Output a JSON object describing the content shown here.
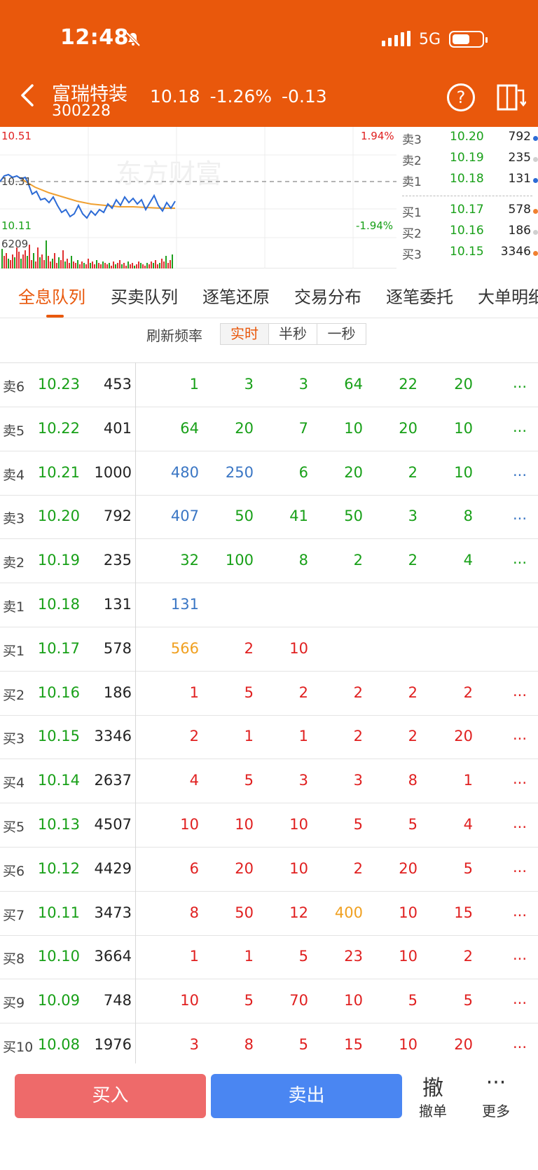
{
  "status": {
    "time": "12:48",
    "network": "5G"
  },
  "stock": {
    "name": "富瑞特装",
    "code": "300228",
    "price": "10.18",
    "pct": "-1.26%",
    "change": "-0.13"
  },
  "chart": {
    "price_high": "10.51",
    "price_low": "10.11",
    "pct_high": "1.94%",
    "pct_low": "-1.94%",
    "volume_label": "6209",
    "ref_label": "10.31",
    "watermark": "东方财富",
    "colors": {
      "price": "#2c6bd6",
      "avg": "#f0a030",
      "vol_up": "#e03030",
      "vol_down": "#20a020"
    }
  },
  "book": {
    "asks": [
      {
        "label": "卖3",
        "price": "10.20",
        "vol": "792",
        "dot": "#2c6bd6"
      },
      {
        "label": "卖2",
        "price": "10.19",
        "vol": "235",
        "dot": "#d0d0d0"
      },
      {
        "label": "卖1",
        "price": "10.18",
        "vol": "131",
        "dot": "#2c6bd6"
      }
    ],
    "bids": [
      {
        "label": "买1",
        "price": "10.17",
        "vol": "578",
        "dot": "#f08030"
      },
      {
        "label": "买2",
        "price": "10.16",
        "vol": "186",
        "dot": "#d0d0d0"
      },
      {
        "label": "买3",
        "price": "10.15",
        "vol": "3346",
        "dot": "#f08030"
      }
    ]
  },
  "tabs": [
    "全息队列",
    "买卖队列",
    "逐笔还原",
    "交易分布",
    "逐笔委托",
    "大单明细"
  ],
  "refresh": {
    "label": "刷新频率",
    "options": [
      "实时",
      "半秒",
      "一秒"
    ]
  },
  "queue": [
    {
      "label": "卖6",
      "price": "10.23",
      "vol": "453",
      "orders": [
        [
          "1",
          "g"
        ],
        [
          "3",
          "g"
        ],
        [
          "3",
          "g"
        ],
        [
          "64",
          "g"
        ],
        [
          "22",
          "g"
        ],
        [
          "20",
          "g"
        ]
      ],
      "more": "..."
    },
    {
      "label": "卖5",
      "price": "10.22",
      "vol": "401",
      "orders": [
        [
          "64",
          "g"
        ],
        [
          "20",
          "g"
        ],
        [
          "7",
          "g"
        ],
        [
          "10",
          "g"
        ],
        [
          "20",
          "g"
        ],
        [
          "10",
          "g"
        ]
      ],
      "more": "..."
    },
    {
      "label": "卖4",
      "price": "10.21",
      "vol": "1000",
      "orders": [
        [
          "480",
          "b"
        ],
        [
          "250",
          "b"
        ],
        [
          "6",
          "g"
        ],
        [
          "20",
          "g"
        ],
        [
          "2",
          "g"
        ],
        [
          "10",
          "g"
        ]
      ],
      "more": "..."
    },
    {
      "label": "卖3",
      "price": "10.20",
      "vol": "792",
      "orders": [
        [
          "407",
          "b"
        ],
        [
          "50",
          "g"
        ],
        [
          "41",
          "g"
        ],
        [
          "50",
          "g"
        ],
        [
          "3",
          "g"
        ],
        [
          "8",
          "g"
        ]
      ],
      "more": "..."
    },
    {
      "label": "卖2",
      "price": "10.19",
      "vol": "235",
      "orders": [
        [
          "32",
          "g"
        ],
        [
          "100",
          "g"
        ],
        [
          "8",
          "g"
        ],
        [
          "2",
          "g"
        ],
        [
          "2",
          "g"
        ],
        [
          "4",
          "g"
        ]
      ],
      "more": "..."
    },
    {
      "label": "卖1",
      "price": "10.18",
      "vol": "131",
      "orders": [
        [
          "131",
          "b"
        ]
      ],
      "more": ""
    },
    {
      "label": "买1",
      "price": "10.17",
      "vol": "578",
      "orders": [
        [
          "566",
          "o"
        ],
        [
          "2",
          "r"
        ],
        [
          "10",
          "r"
        ]
      ],
      "more": ""
    },
    {
      "label": "买2",
      "price": "10.16",
      "vol": "186",
      "orders": [
        [
          "1",
          "r"
        ],
        [
          "5",
          "r"
        ],
        [
          "2",
          "r"
        ],
        [
          "2",
          "r"
        ],
        [
          "2",
          "r"
        ],
        [
          "2",
          "r"
        ]
      ],
      "more": "..."
    },
    {
      "label": "买3",
      "price": "10.15",
      "vol": "3346",
      "orders": [
        [
          "2",
          "r"
        ],
        [
          "1",
          "r"
        ],
        [
          "1",
          "r"
        ],
        [
          "2",
          "r"
        ],
        [
          "2",
          "r"
        ],
        [
          "20",
          "r"
        ]
      ],
      "more": "..."
    },
    {
      "label": "买4",
      "price": "10.14",
      "vol": "2637",
      "orders": [
        [
          "4",
          "r"
        ],
        [
          "5",
          "r"
        ],
        [
          "3",
          "r"
        ],
        [
          "3",
          "r"
        ],
        [
          "8",
          "r"
        ],
        [
          "1",
          "r"
        ]
      ],
      "more": "..."
    },
    {
      "label": "买5",
      "price": "10.13",
      "vol": "4507",
      "orders": [
        [
          "10",
          "r"
        ],
        [
          "10",
          "r"
        ],
        [
          "10",
          "r"
        ],
        [
          "5",
          "r"
        ],
        [
          "5",
          "r"
        ],
        [
          "4",
          "r"
        ]
      ],
      "more": "..."
    },
    {
      "label": "买6",
      "price": "10.12",
      "vol": "4429",
      "orders": [
        [
          "6",
          "r"
        ],
        [
          "20",
          "r"
        ],
        [
          "10",
          "r"
        ],
        [
          "2",
          "r"
        ],
        [
          "20",
          "r"
        ],
        [
          "5",
          "r"
        ]
      ],
      "more": "..."
    },
    {
      "label": "买7",
      "price": "10.11",
      "vol": "3473",
      "orders": [
        [
          "8",
          "r"
        ],
        [
          "50",
          "r"
        ],
        [
          "12",
          "r"
        ],
        [
          "400",
          "o"
        ],
        [
          "10",
          "r"
        ],
        [
          "15",
          "r"
        ]
      ],
      "more": "..."
    },
    {
      "label": "买8",
      "price": "10.10",
      "vol": "3664",
      "orders": [
        [
          "1",
          "r"
        ],
        [
          "1",
          "r"
        ],
        [
          "5",
          "r"
        ],
        [
          "23",
          "r"
        ],
        [
          "10",
          "r"
        ],
        [
          "2",
          "r"
        ]
      ],
      "more": "..."
    },
    {
      "label": "买9",
      "price": "10.09",
      "vol": "748",
      "orders": [
        [
          "10",
          "r"
        ],
        [
          "5",
          "r"
        ],
        [
          "70",
          "r"
        ],
        [
          "10",
          "r"
        ],
        [
          "5",
          "r"
        ],
        [
          "5",
          "r"
        ]
      ],
      "more": "..."
    },
    {
      "label": "买10",
      "price": "10.08",
      "vol": "1976",
      "orders": [
        [
          "3",
          "r"
        ],
        [
          "8",
          "r"
        ],
        [
          "5",
          "r"
        ],
        [
          "15",
          "r"
        ],
        [
          "10",
          "r"
        ],
        [
          "20",
          "r"
        ]
      ],
      "more": "..."
    }
  ],
  "order_colors": {
    "g": "#18a018",
    "b": "#3a76c4",
    "r": "#e02020",
    "o": "#f0a020"
  },
  "actions": {
    "buy": "买入",
    "sell": "卖出",
    "cancel_big": "撤",
    "cancel": "撤单",
    "more_big": "···",
    "more": "更多"
  }
}
